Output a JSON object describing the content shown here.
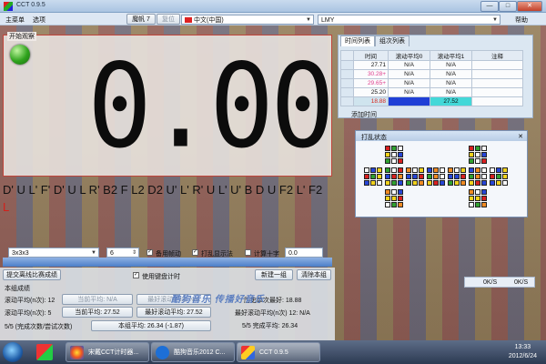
{
  "window": {
    "title": "CCT 0.9.5",
    "min": "—",
    "max": "□",
    "close": "✕"
  },
  "menubar": {
    "menu_main": "主菜单",
    "menu_options": "选项",
    "button_scramble7": "魔帆 7",
    "button_reset": "复位",
    "language": "中文(中国)",
    "user": "LMY",
    "help": "帮助"
  },
  "timer": {
    "label": "开始观察",
    "display": "0.00"
  },
  "scramble": {
    "moves": "D' U L' F' D' U L R' B2 F L2 D2 U' L' R' U L' U' B D U F2 L' F2",
    "last_move": "L"
  },
  "options_row": {
    "puzzle": "3x3x3",
    "count": "6",
    "check1": "备用帧动",
    "check2": "打乱显示法",
    "check3": "计算十字",
    "field": "0.0"
  },
  "actions": {
    "submit_button": "提交离线比赛成绩",
    "use_keyboard": "使用键盘计时",
    "new_session_button": "新建一组",
    "clear_button": "清除本组"
  },
  "session": {
    "title": "本组成绩",
    "rows": [
      {
        "label": "滚动平均(n次): 12",
        "b1": "当前平均: N/A",
        "b2": "最好滚动平均: N/A"
      },
      {
        "label": "滚动平均(n次): 5",
        "b1": "当前平均: 27.52",
        "b2": "最好滚动平均: 27.52"
      },
      {
        "label": "5/5 (完成次数/尝试次数)",
        "b1": "本组平均: 26.34 (-1.87)",
        "b2": ""
      }
    ],
    "right": [
      "历史单次最好: 18.88",
      "最好滚动平均(n次) 12: N/A",
      "5/5 完成平均: 26.34"
    ]
  },
  "right_panel": {
    "tabs": [
      "时间列表",
      "组次列表"
    ],
    "headers": [
      "时间",
      "滚动平均0",
      "滚动平均1",
      "注释"
    ],
    "rows": [
      [
        "27.71",
        "N/A",
        "N/A",
        ""
      ],
      [
        "30.28+",
        "N/A",
        "N/A",
        ""
      ],
      [
        "29.65+",
        "N/A",
        "N/A",
        ""
      ],
      [
        "25.20",
        "N/A",
        "N/A",
        ""
      ],
      [
        "18.88",
        "",
        "27.52",
        ""
      ]
    ],
    "footer_label": "添加时间",
    "colors": {
      "highlight_cyan": "#43d8d8",
      "highlight_blue": "#1f3fd6",
      "best_red": "#d9281f",
      "pink": "#f05ad0"
    }
  },
  "scramble_state": {
    "title": "打乱状态",
    "close": "✕",
    "faces": {
      "U": [
        "#d82020",
        "#30a030",
        "#ffffff",
        "#f1d21c",
        "#ffffff",
        "#2746d6",
        "#30a030",
        "#ffffff",
        "#d82020"
      ],
      "L": [
        "#ffffff",
        "#2746d6",
        "#f1d21c",
        "#d82020",
        "#30a030",
        "#f1d21c",
        "#2746d6",
        "#f1d21c",
        "#ffffff"
      ],
      "F": [
        "#30a030",
        "#ffffff",
        "#d82020",
        "#2746d6",
        "#d82020",
        "#f08a22",
        "#f1d21c",
        "#30a030",
        "#2746d6"
      ],
      "R": [
        "#f08a22",
        "#ffffff",
        "#f1d21c",
        "#2746d6",
        "#2746d6",
        "#d82020",
        "#30a030",
        "#f1d21c",
        "#f08a22"
      ],
      "B": [
        "#2746d6",
        "#f08a22",
        "#ffffff",
        "#30a030",
        "#f08a22",
        "#ffffff",
        "#f1d21c",
        "#d82020",
        "#2746d6"
      ],
      "D": [
        "#f08a22",
        "#ffffff",
        "#2746d6",
        "#f1d21c",
        "#f1d21c",
        "#d82020",
        "#ffffff",
        "#30a030",
        "#f08a22"
      ]
    }
  },
  "mini_widgets": {
    "item1": "0K/S",
    "item2": "0K/S"
  },
  "watermark": "酷狗音乐 传播好音乐",
  "taskbar": {
    "items": [
      "宋戴CCT计时器...",
      "酷狗音乐2012 C...",
      "CCT 0.9.5"
    ],
    "time": "13:33",
    "date": "2012/6/24"
  }
}
